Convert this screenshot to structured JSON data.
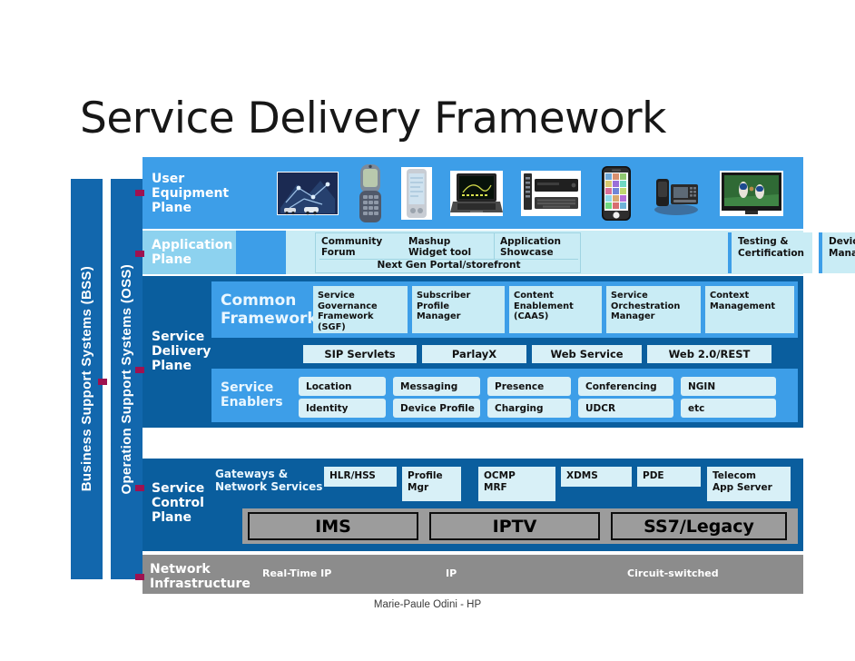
{
  "title": "Service Delivery Framework",
  "footer": "Marie-Paule Odini - HP",
  "colors": {
    "dark_blue": "#0a5e9e",
    "mid_blue": "#3d9ee8",
    "light_cyan": "#c9ecf5",
    "pale_box": "#d8f0f7",
    "bar_blue": "#1267ad",
    "gray": "#8c8c8c",
    "magenta_tab": "#9e1250"
  },
  "sidebar": {
    "bss_label": "Business Support Systems (BSS)",
    "oss_label": "Operation Support Systems (OSS)"
  },
  "planes": {
    "user_equipment": {
      "label": "User\nEquipment\nPlane",
      "label_lines": [
        "User",
        "Equipment",
        "Plane"
      ],
      "devices": [
        "network-scene-icon",
        "flip-phone-icon",
        "pda-icon",
        "laptop-icon",
        "set-top-box-icon",
        "smartphone-icon",
        "desk-phone-icon",
        "television-icon"
      ]
    },
    "application": {
      "label_lines": [
        "Application",
        "Plane"
      ],
      "portal_cells": [
        "Community\nForum",
        "Mashup\nWidget tool",
        "Application\nShowcase"
      ],
      "portal_cell_lines": [
        [
          "Community",
          "Forum"
        ],
        [
          "Mashup",
          "Widget tool"
        ],
        [
          "Application",
          "Showcase"
        ]
      ],
      "portal_caption": "Next Gen Portal/storefront",
      "right_boxes": [
        {
          "lines": [
            "Testing &",
            "Certification"
          ]
        },
        {
          "lines": [
            "Device",
            "Management"
          ]
        }
      ]
    },
    "service_delivery": {
      "label_lines": [
        "Service",
        "Delivery",
        "Plane"
      ],
      "common_framework_title_lines": [
        "Common",
        "Framework"
      ],
      "common_framework_boxes": [
        {
          "lines": [
            "Service",
            "Governance",
            "Framework",
            "(SGF)"
          ]
        },
        {
          "lines": [
            "Subscriber",
            "Profile",
            "Manager"
          ]
        },
        {
          "lines": [
            "Content",
            "Enablement",
            "(CAAS)"
          ]
        },
        {
          "lines": [
            "Service",
            "Orchestration",
            "Manager"
          ]
        },
        {
          "lines": [
            "Context",
            "Management"
          ]
        }
      ],
      "protocols": [
        "SIP Servlets",
        "ParlayX",
        "Web Service",
        "Web 2.0/REST"
      ],
      "service_enablers_title_lines": [
        "Service",
        "Enablers"
      ],
      "enablers_row1": [
        "Location",
        "Messaging",
        "Presence",
        "Conferencing",
        "NGIN"
      ],
      "enablers_row2": [
        "Identity",
        "Device Profile",
        "Charging",
        "UDCR",
        "etc"
      ]
    },
    "service_control": {
      "label_lines": [
        "Service",
        "Control",
        "Plane"
      ],
      "gateways_label_lines": [
        "Gateways &",
        "Network Services"
      ],
      "gateway_boxes": [
        {
          "lines": [
            "HLR/HSS"
          ]
        },
        {
          "lines": [
            "Profile",
            "Mgr"
          ]
        },
        {
          "lines": [
            "OCMP",
            "MRF"
          ]
        },
        {
          "lines": [
            "XDMS"
          ]
        },
        {
          "lines": [
            "PDE"
          ]
        },
        {
          "lines": [
            "Telecom",
            "App Server"
          ]
        }
      ],
      "networks": [
        "IMS",
        "IPTV",
        "SS7/Legacy"
      ]
    },
    "network_infrastructure": {
      "label_lines": [
        "Network",
        "Infrastructure"
      ],
      "technologies": [
        "Real-Time IP",
        "IP",
        "Circuit-switched"
      ]
    }
  }
}
